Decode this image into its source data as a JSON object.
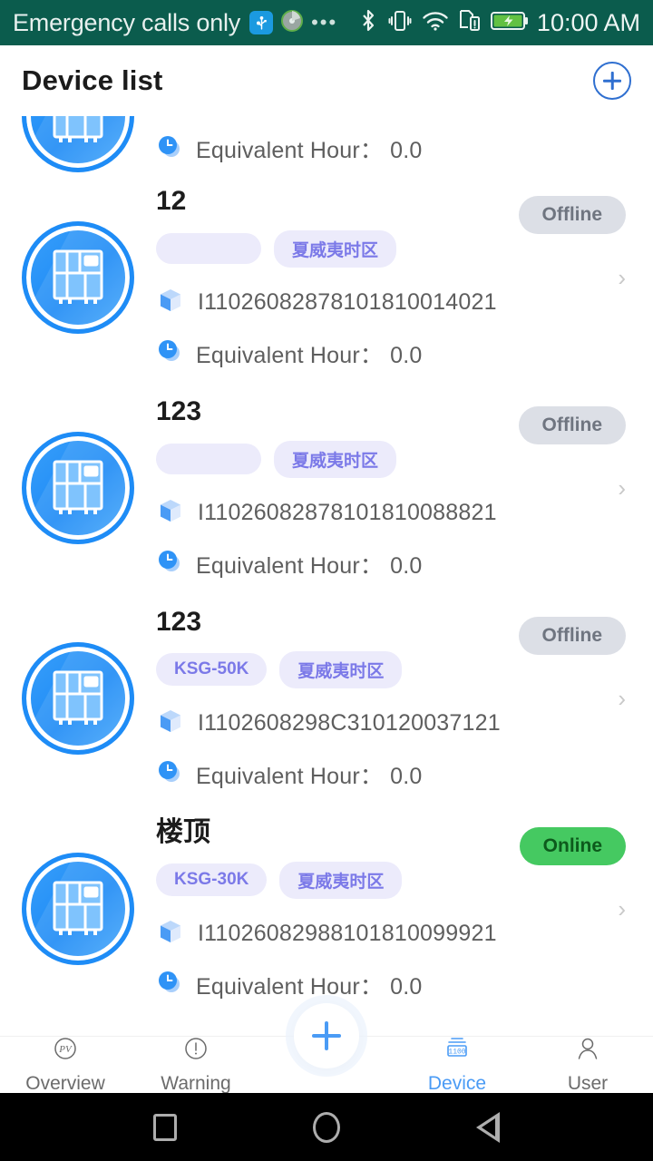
{
  "status_bar": {
    "carrier": "Emergency calls only",
    "time": "10:00 AM",
    "icons": [
      "usb-icon",
      "disc-icon",
      "more-dots-icon",
      "bluetooth-icon",
      "vibrate-icon",
      "wifi-icon",
      "sim-card-icon",
      "battery-charging-icon"
    ]
  },
  "header": {
    "title": "Device list",
    "add_label": "+"
  },
  "labels": {
    "equivalent_hour": "Equivalent Hour：",
    "chevron": "›"
  },
  "colors": {
    "status_bar_bg": "#0b5c4d",
    "accent_blue": "#4a9bf5",
    "tag_bg": "#ecebfb",
    "tag_text": "#7b79e8",
    "offline_bg": "#dcdfe6",
    "offline_text": "#6f7580",
    "online_bg": "#45c961",
    "online_text": "#0d5a1c",
    "title_text": "#1c1c1c"
  },
  "devices": [
    {
      "name": "",
      "status": "",
      "status_kind": "",
      "model_tag": "",
      "timezone_tag": "",
      "serial": "",
      "equivalent_hour_value": "0.0",
      "partial": true
    },
    {
      "name": "12",
      "status": "Offline",
      "status_kind": "offline",
      "model_tag": "",
      "timezone_tag": "夏威夷时区",
      "serial": "I11026082878101810014021",
      "equivalent_hour_value": "0.0",
      "partial": false
    },
    {
      "name": "123",
      "status": "Offline",
      "status_kind": "offline",
      "model_tag": "",
      "timezone_tag": "夏威夷时区",
      "serial": "I11026082878101810088821",
      "equivalent_hour_value": "0.0",
      "partial": false
    },
    {
      "name": "123",
      "status": "Offline",
      "status_kind": "offline",
      "model_tag": "KSG-50K",
      "timezone_tag": "夏威夷时区",
      "serial": "I1102608298C310120037121",
      "equivalent_hour_value": "0.0",
      "partial": false
    },
    {
      "name": "楼顶",
      "status": "Online",
      "status_kind": "online",
      "model_tag": "KSG-30K",
      "timezone_tag": "夏威夷时区",
      "serial": "I11026082988101810099921",
      "equivalent_hour_value": "0.0",
      "partial": false
    }
  ],
  "tabbar": {
    "items": [
      {
        "label": "Overview",
        "icon": "pv-circle-icon",
        "active": false
      },
      {
        "label": "Warning",
        "icon": "exclamation-circle-icon",
        "active": false
      },
      {
        "label": "",
        "icon": "plus-fab-icon",
        "active": false
      },
      {
        "label": "Device",
        "icon": "inverter-icon",
        "active": true
      },
      {
        "label": "User",
        "icon": "person-icon",
        "active": false
      }
    ]
  },
  "android_nav": {
    "buttons": [
      "recents-square-icon",
      "home-circle-icon",
      "back-triangle-icon"
    ]
  }
}
